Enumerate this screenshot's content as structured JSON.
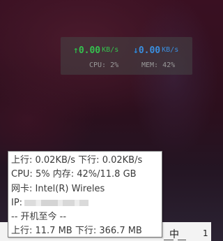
{
  "speed_widget": {
    "upload": {
      "arrow": "↑",
      "value": "0.00",
      "unit": "KB/s"
    },
    "download": {
      "arrow": "↓",
      "value": "0.00",
      "unit": "KB/s"
    },
    "cpu_text": "CPU: 2%",
    "mem_text": "MEM: 42%",
    "colors": {
      "upload": "#35c24f",
      "download": "#3a8fe0",
      "stats": "#9a9a9a"
    }
  },
  "tooltip": {
    "line1": "上行: 0.02KB/s  下行: 0.02KB/s",
    "line2": "CPU: 5%  内存: 42%/11.8 GB",
    "line3": "网卡: Intel(R) Wireles",
    "line4_label": "IP:",
    "line5": "-- 开机至今 --",
    "line6": "上行: 11.7 MB  下行: 366.7 MB"
  },
  "background_strip": {
    "char": "中",
    "number": "1"
  }
}
